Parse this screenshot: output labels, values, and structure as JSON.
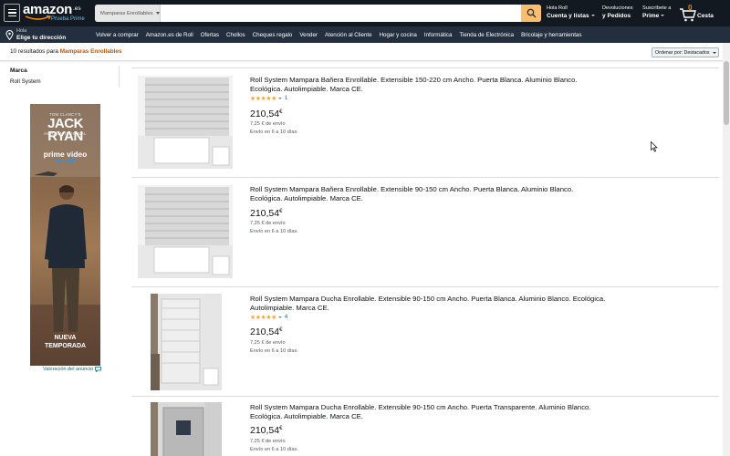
{
  "header": {
    "logo": {
      "text": "amazon",
      "tld": ".es",
      "prime": "Prueba Prime"
    },
    "search": {
      "category": "Mamparas Enrollables",
      "value": "",
      "placeholder": ""
    },
    "account": {
      "line1": "Hola Roll",
      "line2": "Cuenta y listas"
    },
    "orders": {
      "line1": "Devoluciones",
      "line2": "y Pedidos"
    },
    "prime": {
      "line1": "Suscríbete a",
      "line2": "Prime"
    },
    "cart": {
      "count": "0",
      "label": "Cesta"
    }
  },
  "nav": {
    "location": {
      "line1": "Hola",
      "line2": "Elige tu dirección"
    },
    "items": [
      "Volver a comprar",
      "Amazon.es de Roll",
      "Ofertas",
      "Chollos",
      "Cheques regalo",
      "Vender",
      "Atención al Cliente",
      "Hogar y cocina",
      "Informática",
      "Tienda de Electrónica",
      "Bricolaje y herramientas"
    ]
  },
  "results": {
    "prefix": "10 resultados para",
    "query": "Mamparas Enrollables",
    "sort_label": "Ordenar por: Destacados"
  },
  "filters": {
    "heading": "Marca",
    "items": [
      "Roll System"
    ]
  },
  "ad": {
    "brand": "TOM CLANCY'S",
    "title_line1": "JACK",
    "title_line2": "RYAN",
    "subtitle": "AMAZON ORIGINAL",
    "service": "prime video",
    "tagline_line1": "NUEVA",
    "tagline_line2": "TEMPORADA",
    "feedback": "Valoración del anuncio"
  },
  "products": [
    {
      "title": "Roll System Mampara Bañera Enrollable. Extensible 150-220 cm Ancho. Puerta Blanca. Aluminio Blanco. Ecológica. Autolimpiable. Marca CE.",
      "rating_count": "1",
      "price": "210,54",
      "currency": "€",
      "shipping": "7,25 € de envío",
      "eta": "Envío en 6 a 10 días."
    },
    {
      "title": "Roll System Mampara Bañera Enrollable. Extensible 90-150 cm Ancho. Puerta Blanca. Aluminio Blanco. Ecológica. Autolimpiable. Marca CE.",
      "rating_count": "",
      "price": "210,54",
      "currency": "€",
      "shipping": "7,25 € de envío",
      "eta": "Envío en 6 a 10 días."
    },
    {
      "title": "Roll System Mampara Ducha Enrollable. Extensible 90-150 cm Ancho. Puerta Blanca. Aluminio Blanco. Ecológica. Autolimpiable. Marca CE.",
      "rating_count": "4",
      "price": "210,54",
      "currency": "€",
      "shipping": "7,25 € de envío",
      "eta": "Envío en 6 a 10 días."
    },
    {
      "title": "Roll System Mampara Ducha Enrollable. Extensible 90-150 cm Ancho. Puerta Transparente. Aluminio Blanco. Ecológica. Autolimpiable. Marca CE.",
      "rating_count": "",
      "price": "210,54",
      "currency": "€",
      "shipping": "7,25 € de envío",
      "eta": "Envío en 6 a 10 días."
    }
  ],
  "colors": {
    "header": "#131921",
    "nav": "#232f3e",
    "search_button": "#febd69",
    "query": "#c45500",
    "link": "#007185",
    "star": "#ffa41c"
  },
  "icons": {
    "menu": "hamburger-icon",
    "search": "magnifier-icon",
    "cart": "cart-icon",
    "location": "pin-icon"
  }
}
